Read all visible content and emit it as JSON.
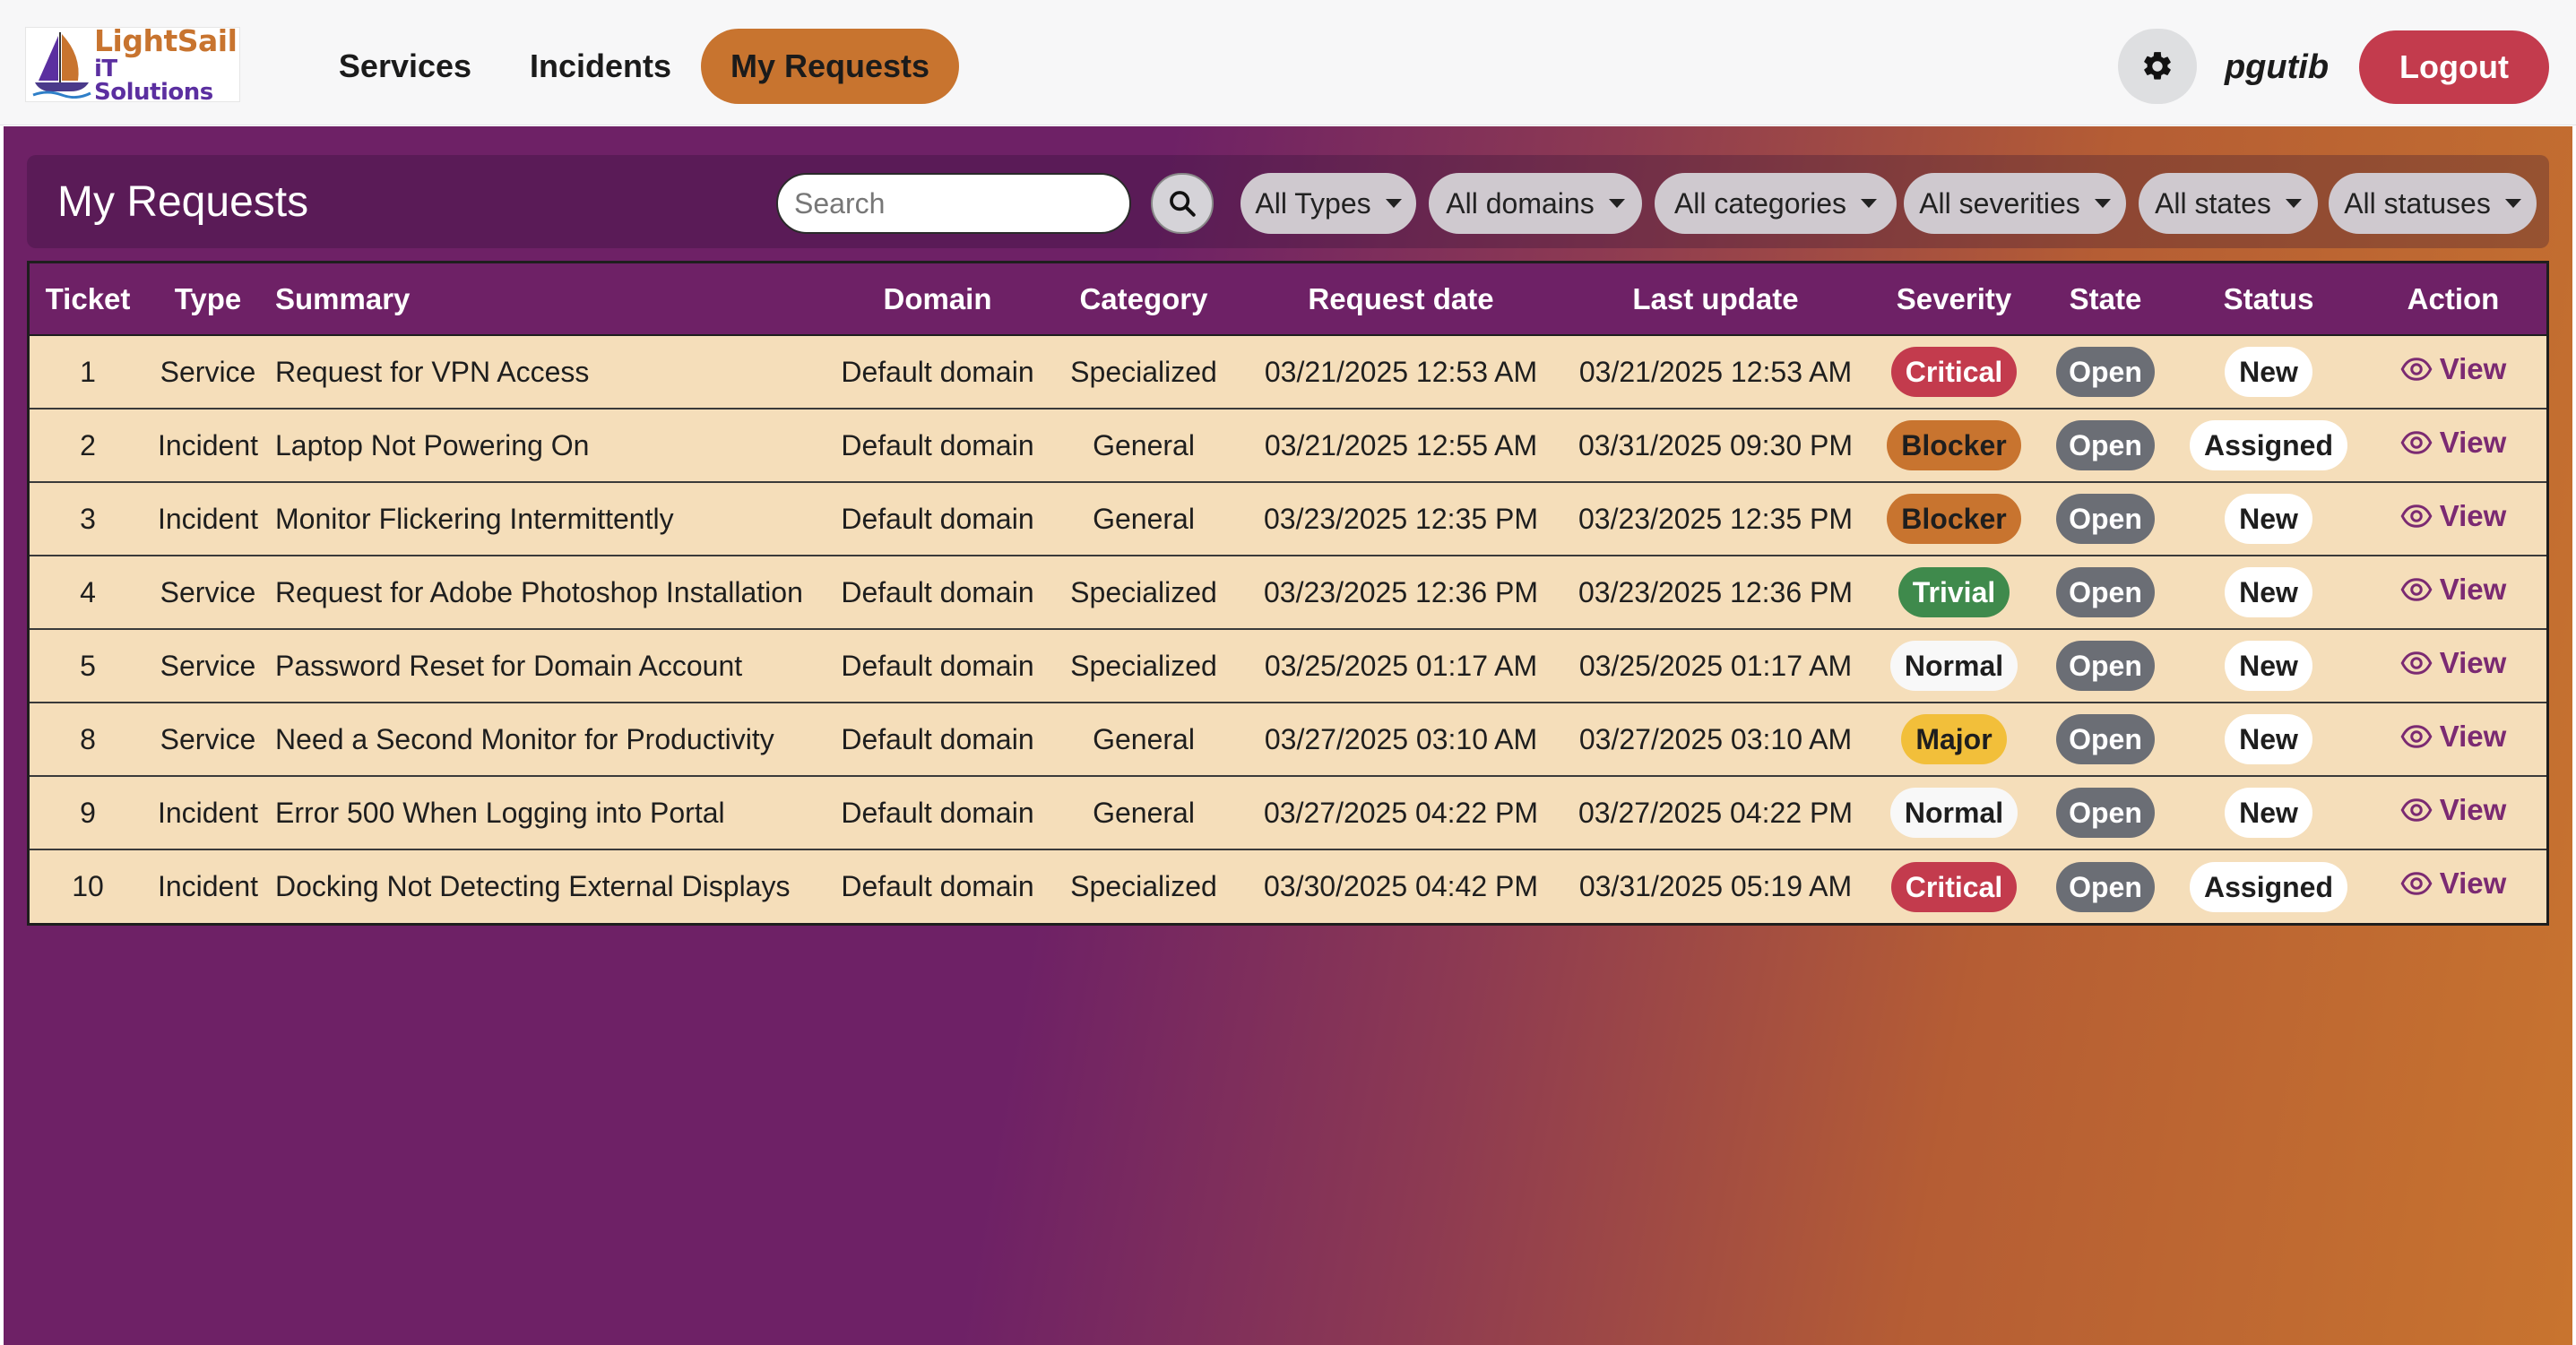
{
  "brand": {
    "line1": "LightSail",
    "line2": "iT Solutions",
    "colors": {
      "orange": "#c8742f",
      "purple": "#6e2166",
      "red": "#c33b4d"
    }
  },
  "nav": {
    "services": "Services",
    "incidents": "Incidents",
    "my_requests": "My Requests",
    "active": "my_requests"
  },
  "user": {
    "settings_icon": "gear-icon",
    "username": "pgutib",
    "logout": "Logout"
  },
  "header": {
    "title": "My Requests",
    "search_placeholder": "Search",
    "search_icon": "search-icon",
    "filters": {
      "types": "All Types",
      "domains": "All domains",
      "categories": "All categories",
      "severities": "All severities",
      "states": "All states",
      "statuses": "All statuses"
    }
  },
  "table": {
    "columns": {
      "ticket": "Ticket",
      "type": "Type",
      "summary": "Summary",
      "domain": "Domain",
      "category": "Category",
      "request_date": "Request date",
      "last_update": "Last update",
      "severity": "Severity",
      "state": "State",
      "status": "Status",
      "action": "Action"
    },
    "view_label": "View",
    "view_icon": "eye-icon",
    "rows": [
      {
        "ticket": "1",
        "type": "Service",
        "summary": "Request for VPN Access",
        "domain": "Default domain",
        "category": "Specialized",
        "request_date": "03/21/2025 12:53 AM",
        "last_update": "03/21/2025 12:53 AM",
        "severity": "Critical",
        "state": "Open",
        "status": "New"
      },
      {
        "ticket": "2",
        "type": "Incident",
        "summary": "Laptop Not Powering On",
        "domain": "Default domain",
        "category": "General",
        "request_date": "03/21/2025 12:55 AM",
        "last_update": "03/31/2025 09:30 PM",
        "severity": "Blocker",
        "state": "Open",
        "status": "Assigned"
      },
      {
        "ticket": "3",
        "type": "Incident",
        "summary": "Monitor Flickering Intermittently",
        "domain": "Default domain",
        "category": "General",
        "request_date": "03/23/2025 12:35 PM",
        "last_update": "03/23/2025 12:35 PM",
        "severity": "Blocker",
        "state": "Open",
        "status": "New"
      },
      {
        "ticket": "4",
        "type": "Service",
        "summary": "Request for Adobe Photoshop Installation",
        "domain": "Default domain",
        "category": "Specialized",
        "request_date": "03/23/2025 12:36 PM",
        "last_update": "03/23/2025 12:36 PM",
        "severity": "Trivial",
        "state": "Open",
        "status": "New"
      },
      {
        "ticket": "5",
        "type": "Service",
        "summary": "Password Reset for Domain Account",
        "domain": "Default domain",
        "category": "Specialized",
        "request_date": "03/25/2025 01:17 AM",
        "last_update": "03/25/2025 01:17 AM",
        "severity": "Normal",
        "state": "Open",
        "status": "New"
      },
      {
        "ticket": "8",
        "type": "Service",
        "summary": "Need a Second Monitor for Productivity",
        "domain": "Default domain",
        "category": "General",
        "request_date": "03/27/2025 03:10 AM",
        "last_update": "03/27/2025 03:10 AM",
        "severity": "Major",
        "state": "Open",
        "status": "New"
      },
      {
        "ticket": "9",
        "type": "Incident",
        "summary": "Error 500 When Logging into Portal",
        "domain": "Default domain",
        "category": "General",
        "request_date": "03/27/2025 04:22 PM",
        "last_update": "03/27/2025 04:22 PM",
        "severity": "Normal",
        "state": "Open",
        "status": "New"
      },
      {
        "ticket": "10",
        "type": "Incident",
        "summary": "Docking Not Detecting External Displays",
        "domain": "Default domain",
        "category": "Specialized",
        "request_date": "03/30/2025 04:42 PM",
        "last_update": "03/31/2025 05:19 AM",
        "severity": "Critical",
        "state": "Open",
        "status": "Assigned"
      }
    ]
  }
}
